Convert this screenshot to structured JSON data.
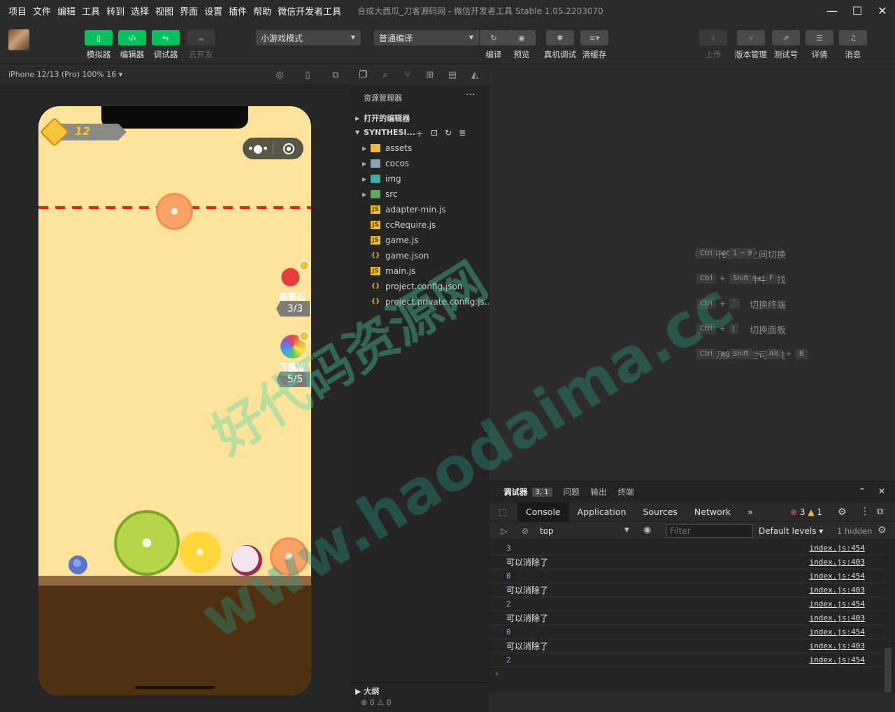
{
  "menubar": {
    "items": [
      "项目",
      "文件",
      "编辑",
      "工具",
      "转到",
      "选择",
      "视图",
      "界面",
      "设置",
      "插件",
      "帮助",
      "微信开发者工具"
    ],
    "title": "合成大西瓜_刀客源码网 - 微信开发者工具 Stable 1.05.2203070"
  },
  "toolbar": {
    "simulator": "模拟器",
    "editor": "编辑器",
    "debugger": "调试器",
    "cloud": "云开发",
    "mode_select": "小游戏模式",
    "compile_select": "普通编译",
    "compile": "编译",
    "preview": "预览",
    "real_debug": "真机调试",
    "clear_cache": "清缓存",
    "upload": "上传",
    "version": "版本管理",
    "test": "测试号",
    "details": "详情",
    "messages": "消息"
  },
  "simulator": {
    "device": "iPhone 12/13 (Pro) 100% 16 ▾",
    "score": "12",
    "magnet": {
      "name": "吸铁石",
      "count": "3/3"
    },
    "rainbow": {
      "name": "万能球",
      "count": "5/5"
    }
  },
  "explorer": {
    "title": "资源管理器",
    "open_editors": "打开的编辑器",
    "project": "SYNTHESI...",
    "files": [
      {
        "name": "assets",
        "type": "folder"
      },
      {
        "name": "cocos",
        "type": "folder"
      },
      {
        "name": "img",
        "type": "folder"
      },
      {
        "name": "src",
        "type": "folder"
      },
      {
        "name": "adapter-min.js",
        "type": "js"
      },
      {
        "name": "ccRequire.js",
        "type": "js"
      },
      {
        "name": "game.js",
        "type": "js"
      },
      {
        "name": "game.json",
        "type": "json"
      },
      {
        "name": "main.js",
        "type": "js"
      },
      {
        "name": "project.config.json",
        "type": "json"
      },
      {
        "name": "project.private.config.js...",
        "type": "json"
      }
    ],
    "outline": "大纲",
    "status_errors": "0",
    "status_warnings": "0"
  },
  "shortcuts": [
    {
      "label": "在打开的文件之间切换",
      "keys": [
        "Ctrl",
        "1 ~ 9"
      ]
    },
    {
      "label": "在文件中查找",
      "keys": [
        "Ctrl",
        "Shift",
        "F"
      ]
    },
    {
      "label": "切换终端",
      "keys": [
        "Ctrl",
        "`"
      ]
    },
    {
      "label": "切换面板",
      "keys": [
        "Ctrl",
        "J"
      ]
    },
    {
      "label": "切换侧边栏可见性",
      "keys": [
        "Ctrl",
        "Shift",
        "Alt",
        "B"
      ]
    }
  ],
  "debugger": {
    "tab_debugger": "调试器",
    "badge": "3, 1",
    "tab_problems": "问题",
    "tab_output": "输出",
    "tab_terminal": "终端",
    "devtools_tabs": [
      "Console",
      "Application",
      "Sources",
      "Network"
    ],
    "errors": "3",
    "warnings": "1",
    "context": "top",
    "filter_placeholder": "Filter",
    "levels": "Default levels ▾",
    "hidden": "1 hidden",
    "lines": [
      {
        "msg": "3",
        "num": true,
        "src": "index.js:454"
      },
      {
        "msg": "可以消除了",
        "num": false,
        "src": "index.js:403"
      },
      {
        "msg": "0",
        "num": true,
        "src": "index.js:454"
      },
      {
        "msg": "可以消除了",
        "num": false,
        "src": "index.js:403"
      },
      {
        "msg": "2",
        "num": true,
        "src": "index.js:454"
      },
      {
        "msg": "可以消除了",
        "num": false,
        "src": "index.js:403"
      },
      {
        "msg": "0",
        "num": true,
        "src": "index.js:454"
      },
      {
        "msg": "可以消除了",
        "num": false,
        "src": "index.js:403"
      },
      {
        "msg": "2",
        "num": true,
        "src": "index.js:454"
      }
    ]
  },
  "watermark": {
    "line1": "好代码资源网",
    "line2": "www.haodaima.cc"
  },
  "colors": {
    "accent": "#07c160",
    "deadline": "#ff1a1a"
  }
}
